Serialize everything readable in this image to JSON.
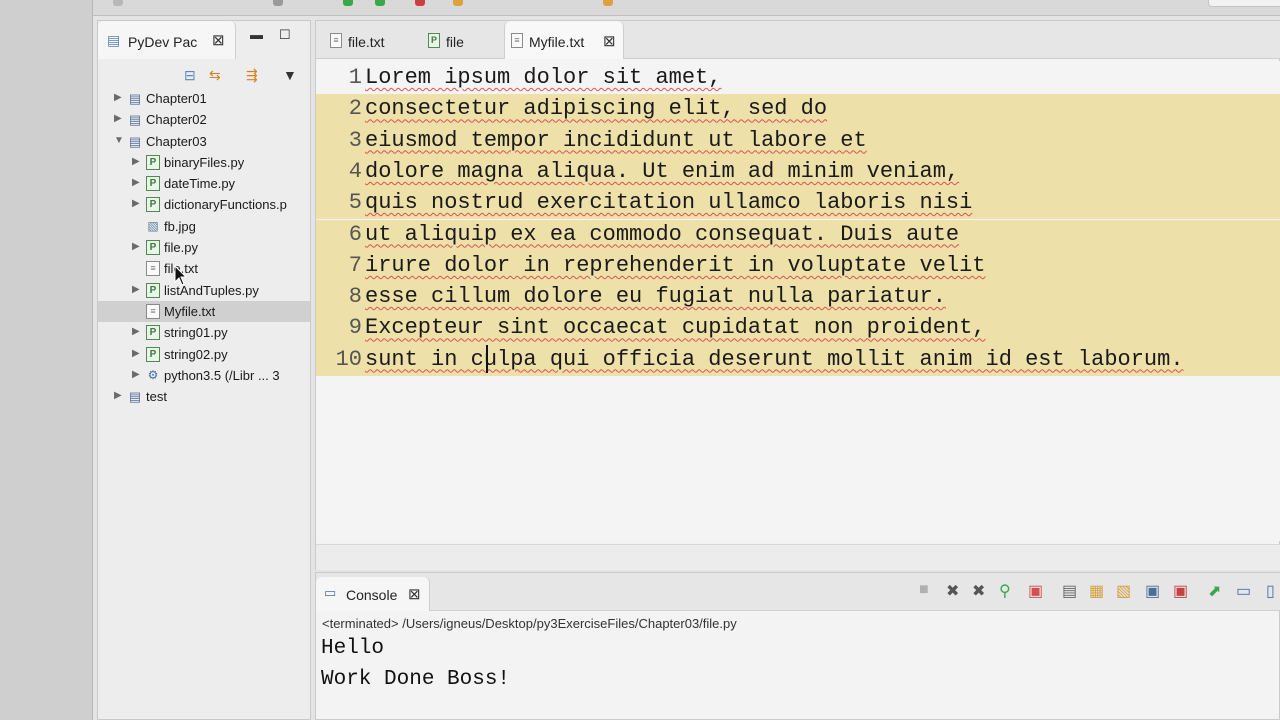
{
  "explorer": {
    "tab_label": "PyDev Pac",
    "tree": [
      {
        "label": "Chapter01",
        "kind": "project",
        "expanded": false,
        "depth": 0
      },
      {
        "label": "Chapter02",
        "kind": "project",
        "expanded": false,
        "depth": 0
      },
      {
        "label": "Chapter03",
        "kind": "project",
        "expanded": true,
        "depth": 0
      },
      {
        "label": "binaryFiles.py",
        "kind": "py",
        "expanded": false,
        "depth": 1
      },
      {
        "label": "dateTime.py",
        "kind": "py",
        "expanded": false,
        "depth": 1
      },
      {
        "label": "dictionaryFunctions.p",
        "kind": "py",
        "expanded": false,
        "depth": 1
      },
      {
        "label": "fb.jpg",
        "kind": "jpg",
        "expanded": null,
        "depth": 1
      },
      {
        "label": "file.py",
        "kind": "py",
        "expanded": false,
        "depth": 1
      },
      {
        "label": "file.txt",
        "kind": "txt",
        "expanded": null,
        "depth": 1
      },
      {
        "label": "listAndTuples.py",
        "kind": "py",
        "expanded": false,
        "depth": 1
      },
      {
        "label": "Myfile.txt",
        "kind": "txt",
        "expanded": null,
        "depth": 1,
        "selected": true
      },
      {
        "label": "string01.py",
        "kind": "py",
        "expanded": false,
        "depth": 1
      },
      {
        "label": "string02.py",
        "kind": "py",
        "expanded": false,
        "depth": 1
      },
      {
        "label": "python3.5  (/Libr ... 3",
        "kind": "pyenv",
        "expanded": false,
        "depth": 1
      },
      {
        "label": "test",
        "kind": "project",
        "expanded": false,
        "depth": 0
      }
    ]
  },
  "editor": {
    "tabs": [
      {
        "label": "file.txt",
        "icon": "txt-file-icon"
      },
      {
        "label": "file",
        "icon": "py-file-icon"
      },
      {
        "label": "Myfile.txt",
        "icon": "txt-file-icon",
        "active": true
      }
    ],
    "lines": [
      {
        "num": "1",
        "text": "Lorem ipsum dolor sit amet,"
      },
      {
        "num": "2",
        "text": "consectetur adipiscing elit, sed do"
      },
      {
        "num": "3",
        "text": "eiusmod tempor incididunt ut labore et"
      },
      {
        "num": "4",
        "text": "dolore magna aliqua. Ut enim ad minim veniam,"
      },
      {
        "num": "5",
        "text": "quis nostrud exercitation ullamco laboris nisi"
      },
      {
        "num": "6",
        "text": "ut aliquip ex ea commodo consequat. Duis aute"
      },
      {
        "num": "7",
        "text": "irure dolor in reprehenderit in voluptate velit"
      },
      {
        "num": "8",
        "text": "esse cillum dolore eu fugiat nulla pariatur."
      },
      {
        "num": "9",
        "text": "Excepteur sint occaecat cupidatat non proident,"
      },
      {
        "num": "10",
        "text": "sunt in culpa qui officia deserunt mollit anim id est laborum."
      }
    ],
    "selection_color": "#ede0a8"
  },
  "console": {
    "tab_label": "Console",
    "path": "<terminated> /Users/igneus/Desktop/py3ExerciseFiles/Chapter03/file.py",
    "output": [
      "Hello",
      "Work Done Boss!"
    ]
  },
  "colors": {
    "py_icon": "#3d7a3d",
    "folder_icon": "#556f99",
    "spell_underline": "#e05050"
  }
}
